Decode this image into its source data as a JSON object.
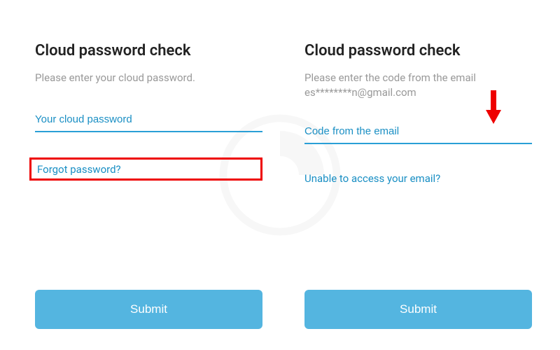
{
  "left": {
    "title": "Cloud password check",
    "subtitle": "Please enter your cloud password.",
    "input_placeholder": "Your cloud password",
    "forgot_link": "Forgot password?",
    "submit_label": "Submit"
  },
  "right": {
    "title": "Cloud password check",
    "subtitle": "Please enter the code from the email es********n@gmail.com",
    "input_placeholder": "Code from the email",
    "unable_link": "Unable to access your email?",
    "submit_label": "Submit"
  },
  "annotations": {
    "highlight_color": "#e00",
    "arrow_color": "#e00"
  }
}
